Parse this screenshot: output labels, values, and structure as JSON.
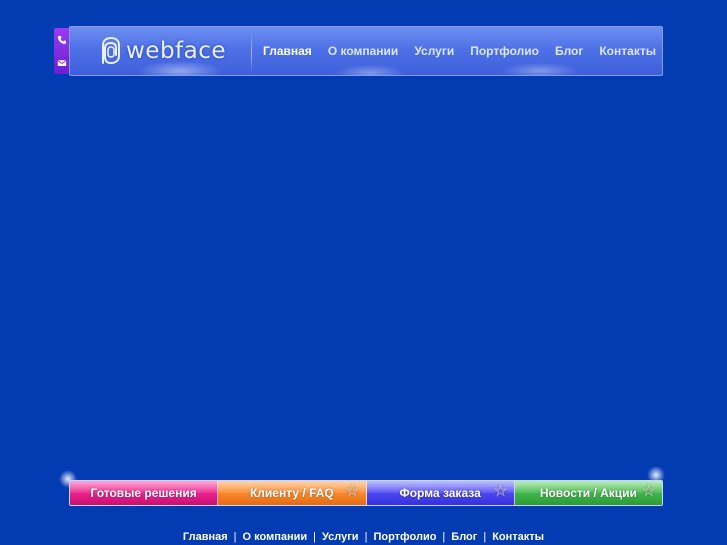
{
  "colors": {
    "background": "#033bb3",
    "header": "#4f71e6",
    "side_strip": "#8a2fe8",
    "btn_pink": "#e8208a",
    "btn_orange": "#f7862b",
    "btn_blue": "#4a45f0",
    "btn_green": "#3fb34a"
  },
  "side_icons": [
    "phone-icon",
    "mail-icon"
  ],
  "logo": {
    "wordmark": "webface"
  },
  "top_nav": [
    "Главная",
    "О компании",
    "Услуги",
    "Портфолио",
    "Блог",
    "Контакты"
  ],
  "buttons": [
    "Готовые решения",
    "Клиенту / FAQ",
    "Форма заказа",
    "Новости / Акции"
  ],
  "footer_nav": [
    "Главная",
    "О компании",
    "Услуги",
    "Портфолио",
    "Блог",
    "Контакты"
  ],
  "footer_separator": "|"
}
